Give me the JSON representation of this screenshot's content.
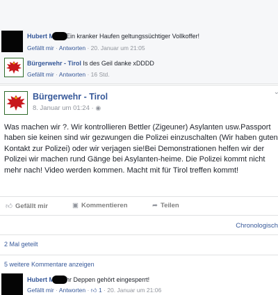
{
  "comments_top": [
    {
      "author": "Hubert M",
      "text": "Ein kranker Haufen geltungssüchtiger Vollkoffer!",
      "like": "Gefällt mir",
      "reply": "Antworten",
      "time": "20. Januar um 21:05"
    },
    {
      "author": "Bürgerwehr - Tirol",
      "text": "Is des Geil danke xDDDD",
      "like": "Gefällt mir",
      "reply": "Antworten",
      "time": "16 Std."
    }
  ],
  "post": {
    "author": "Bürgerwehr - Tirol",
    "date": "8. Januar um 01:24 · ",
    "globe_icon": "globe-icon",
    "body": "Was machen wir ?. Wir kontrollieren Bettler (Zigeuner) Asylanten usw.Passport haben sie keinen sind wir gezwungen die Polizei einzuschalten (Wir haben guten Kontakt zur Polizei) oder wir verjagen sie!Bei Demonstrationen helfen wir der Polizei wir machen rund Gänge bei Asylanten-heime. Die Polizei kommt nicht mehr nach! Video werden kommen. Macht mit für Tirol treffen kommt!",
    "actions": {
      "like": "Gefällt mir",
      "comment": "Kommentieren",
      "share": "Teilen"
    },
    "sort": "Chronologisch",
    "shares": "2 Mal geteilt",
    "more_comments": "5 weitere Kommentare anzeigen"
  },
  "comment_bottom": {
    "author": "Hubert M",
    "text": "hr Deppen gehört eingesperrt!",
    "like": "Gefällt mir",
    "reply": "Antworten",
    "like_count": "1",
    "time": "20. Januar um 21:06"
  },
  "colors": {
    "link": "#365899",
    "meta": "#90949c",
    "eagle_red": "#c8191e",
    "eagle_green": "#2e6a2a"
  }
}
